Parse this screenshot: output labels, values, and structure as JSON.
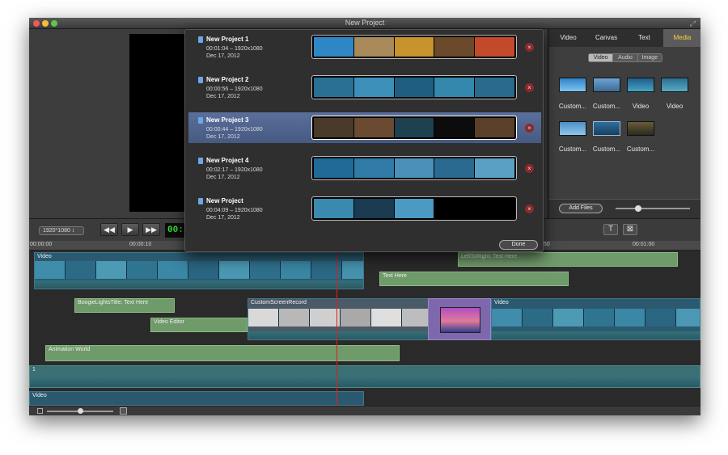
{
  "window": {
    "title": "New Project"
  },
  "right_panel": {
    "tabs": [
      "Video",
      "Canvas",
      "Text",
      "Media"
    ],
    "active_tab": "Media",
    "media_types": [
      "Video",
      "Audio",
      "Image"
    ],
    "media_items": [
      "Custom...",
      "Custom...",
      "Video",
      "Video",
      "Custom...",
      "Custom...",
      "Custom..."
    ],
    "add_files_label": "Add Files"
  },
  "controls": {
    "resolution": "1920*1080 ↕",
    "timecode": "00:",
    "rewind_label": "◀◀",
    "play_label": "▶",
    "forward_label": "▶▶",
    "text_tool_label": "T",
    "image_tool_label": "⊠"
  },
  "ruler": {
    "ticks": [
      "00:00:00",
      "00:00:10",
      "50",
      "00:01:00"
    ]
  },
  "projects": [
    {
      "name": "New Project 1",
      "duration": "00:01:04 – 1920x1080",
      "date": "Dec 17, 2012"
    },
    {
      "name": "New Project 2",
      "duration": "00:00:56 – 1920x1080",
      "date": "Dec 17, 2012"
    },
    {
      "name": "New Project 3",
      "duration": "00:00:44 – 1920x1080",
      "date": "Dec 17, 2012"
    },
    {
      "name": "New Project 4",
      "duration": "00:02:17 – 1920x1080",
      "date": "Dec 17, 2012"
    },
    {
      "name": "New Project",
      "duration": "00:04:09 – 1920x1080",
      "date": "Dec 17, 2012"
    }
  ],
  "popup": {
    "done_label": "Done"
  },
  "timeline": {
    "clips": {
      "video_top": "Video",
      "left_to_right": "LeftToRight: Text Here",
      "text_here": "Text Here",
      "boogie": "BoogieLightsTitle: Text Here",
      "custom_screen": "CustomScreenRecord",
      "video_right": "Video",
      "video_editor": "Video Editor",
      "animation_world": "Animation World",
      "track_one": "1",
      "video_bottom": "Video"
    }
  },
  "colors": {
    "accent_tab": "#f5d33a",
    "timecode": "#36e036",
    "playhead": "#e01e1e",
    "text_clip": "#6f9a6a",
    "video_clip": "#2b5a70"
  }
}
